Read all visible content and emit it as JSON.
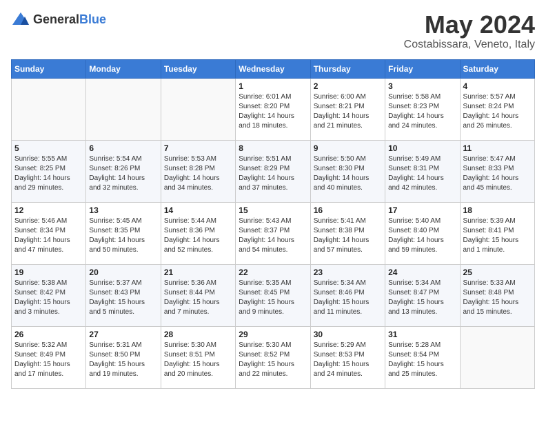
{
  "header": {
    "logo_general": "General",
    "logo_blue": "Blue",
    "month_year": "May 2024",
    "location": "Costabissara, Veneto, Italy"
  },
  "days_of_week": [
    "Sunday",
    "Monday",
    "Tuesday",
    "Wednesday",
    "Thursday",
    "Friday",
    "Saturday"
  ],
  "weeks": [
    [
      {
        "day": "",
        "info": ""
      },
      {
        "day": "",
        "info": ""
      },
      {
        "day": "",
        "info": ""
      },
      {
        "day": "1",
        "info": "Sunrise: 6:01 AM\nSunset: 8:20 PM\nDaylight: 14 hours and 18 minutes."
      },
      {
        "day": "2",
        "info": "Sunrise: 6:00 AM\nSunset: 8:21 PM\nDaylight: 14 hours and 21 minutes."
      },
      {
        "day": "3",
        "info": "Sunrise: 5:58 AM\nSunset: 8:23 PM\nDaylight: 14 hours and 24 minutes."
      },
      {
        "day": "4",
        "info": "Sunrise: 5:57 AM\nSunset: 8:24 PM\nDaylight: 14 hours and 26 minutes."
      }
    ],
    [
      {
        "day": "5",
        "info": "Sunrise: 5:55 AM\nSunset: 8:25 PM\nDaylight: 14 hours and 29 minutes."
      },
      {
        "day": "6",
        "info": "Sunrise: 5:54 AM\nSunset: 8:26 PM\nDaylight: 14 hours and 32 minutes."
      },
      {
        "day": "7",
        "info": "Sunrise: 5:53 AM\nSunset: 8:28 PM\nDaylight: 14 hours and 34 minutes."
      },
      {
        "day": "8",
        "info": "Sunrise: 5:51 AM\nSunset: 8:29 PM\nDaylight: 14 hours and 37 minutes."
      },
      {
        "day": "9",
        "info": "Sunrise: 5:50 AM\nSunset: 8:30 PM\nDaylight: 14 hours and 40 minutes."
      },
      {
        "day": "10",
        "info": "Sunrise: 5:49 AM\nSunset: 8:31 PM\nDaylight: 14 hours and 42 minutes."
      },
      {
        "day": "11",
        "info": "Sunrise: 5:47 AM\nSunset: 8:33 PM\nDaylight: 14 hours and 45 minutes."
      }
    ],
    [
      {
        "day": "12",
        "info": "Sunrise: 5:46 AM\nSunset: 8:34 PM\nDaylight: 14 hours and 47 minutes."
      },
      {
        "day": "13",
        "info": "Sunrise: 5:45 AM\nSunset: 8:35 PM\nDaylight: 14 hours and 50 minutes."
      },
      {
        "day": "14",
        "info": "Sunrise: 5:44 AM\nSunset: 8:36 PM\nDaylight: 14 hours and 52 minutes."
      },
      {
        "day": "15",
        "info": "Sunrise: 5:43 AM\nSunset: 8:37 PM\nDaylight: 14 hours and 54 minutes."
      },
      {
        "day": "16",
        "info": "Sunrise: 5:41 AM\nSunset: 8:38 PM\nDaylight: 14 hours and 57 minutes."
      },
      {
        "day": "17",
        "info": "Sunrise: 5:40 AM\nSunset: 8:40 PM\nDaylight: 14 hours and 59 minutes."
      },
      {
        "day": "18",
        "info": "Sunrise: 5:39 AM\nSunset: 8:41 PM\nDaylight: 15 hours and 1 minute."
      }
    ],
    [
      {
        "day": "19",
        "info": "Sunrise: 5:38 AM\nSunset: 8:42 PM\nDaylight: 15 hours and 3 minutes."
      },
      {
        "day": "20",
        "info": "Sunrise: 5:37 AM\nSunset: 8:43 PM\nDaylight: 15 hours and 5 minutes."
      },
      {
        "day": "21",
        "info": "Sunrise: 5:36 AM\nSunset: 8:44 PM\nDaylight: 15 hours and 7 minutes."
      },
      {
        "day": "22",
        "info": "Sunrise: 5:35 AM\nSunset: 8:45 PM\nDaylight: 15 hours and 9 minutes."
      },
      {
        "day": "23",
        "info": "Sunrise: 5:34 AM\nSunset: 8:46 PM\nDaylight: 15 hours and 11 minutes."
      },
      {
        "day": "24",
        "info": "Sunrise: 5:34 AM\nSunset: 8:47 PM\nDaylight: 15 hours and 13 minutes."
      },
      {
        "day": "25",
        "info": "Sunrise: 5:33 AM\nSunset: 8:48 PM\nDaylight: 15 hours and 15 minutes."
      }
    ],
    [
      {
        "day": "26",
        "info": "Sunrise: 5:32 AM\nSunset: 8:49 PM\nDaylight: 15 hours and 17 minutes."
      },
      {
        "day": "27",
        "info": "Sunrise: 5:31 AM\nSunset: 8:50 PM\nDaylight: 15 hours and 19 minutes."
      },
      {
        "day": "28",
        "info": "Sunrise: 5:30 AM\nSunset: 8:51 PM\nDaylight: 15 hours and 20 minutes."
      },
      {
        "day": "29",
        "info": "Sunrise: 5:30 AM\nSunset: 8:52 PM\nDaylight: 15 hours and 22 minutes."
      },
      {
        "day": "30",
        "info": "Sunrise: 5:29 AM\nSunset: 8:53 PM\nDaylight: 15 hours and 24 minutes."
      },
      {
        "day": "31",
        "info": "Sunrise: 5:28 AM\nSunset: 8:54 PM\nDaylight: 15 hours and 25 minutes."
      },
      {
        "day": "",
        "info": ""
      }
    ]
  ]
}
